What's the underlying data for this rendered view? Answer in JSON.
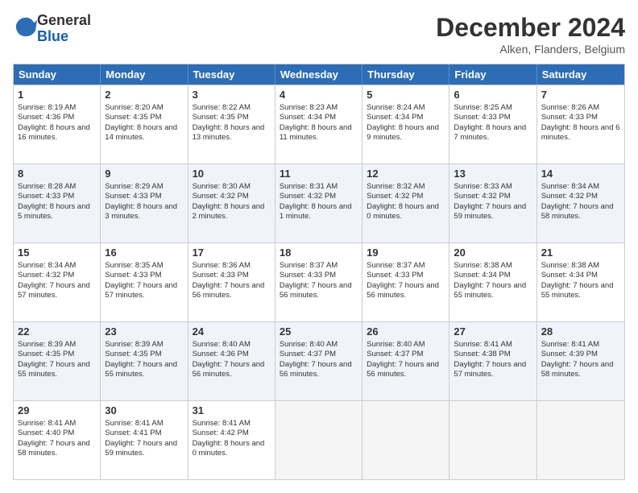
{
  "logo": {
    "line1": "General",
    "line2": "Blue"
  },
  "title": "December 2024",
  "location": "Alken, Flanders, Belgium",
  "days": [
    "Sunday",
    "Monday",
    "Tuesday",
    "Wednesday",
    "Thursday",
    "Friday",
    "Saturday"
  ],
  "weeks": [
    [
      {
        "day": "1",
        "info": "Sunrise: 8:19 AM\nSunset: 4:36 PM\nDaylight: 8 hours and 16 minutes."
      },
      {
        "day": "2",
        "info": "Sunrise: 8:20 AM\nSunset: 4:35 PM\nDaylight: 8 hours and 14 minutes."
      },
      {
        "day": "3",
        "info": "Sunrise: 8:22 AM\nSunset: 4:35 PM\nDaylight: 8 hours and 13 minutes."
      },
      {
        "day": "4",
        "info": "Sunrise: 8:23 AM\nSunset: 4:34 PM\nDaylight: 8 hours and 11 minutes."
      },
      {
        "day": "5",
        "info": "Sunrise: 8:24 AM\nSunset: 4:34 PM\nDaylight: 8 hours and 9 minutes."
      },
      {
        "day": "6",
        "info": "Sunrise: 8:25 AM\nSunset: 4:33 PM\nDaylight: 8 hours and 7 minutes."
      },
      {
        "day": "7",
        "info": "Sunrise: 8:26 AM\nSunset: 4:33 PM\nDaylight: 8 hours and 6 minutes."
      }
    ],
    [
      {
        "day": "8",
        "info": "Sunrise: 8:28 AM\nSunset: 4:33 PM\nDaylight: 8 hours and 5 minutes."
      },
      {
        "day": "9",
        "info": "Sunrise: 8:29 AM\nSunset: 4:33 PM\nDaylight: 8 hours and 3 minutes."
      },
      {
        "day": "10",
        "info": "Sunrise: 8:30 AM\nSunset: 4:32 PM\nDaylight: 8 hours and 2 minutes."
      },
      {
        "day": "11",
        "info": "Sunrise: 8:31 AM\nSunset: 4:32 PM\nDaylight: 8 hours and 1 minute."
      },
      {
        "day": "12",
        "info": "Sunrise: 8:32 AM\nSunset: 4:32 PM\nDaylight: 8 hours and 0 minutes."
      },
      {
        "day": "13",
        "info": "Sunrise: 8:33 AM\nSunset: 4:32 PM\nDaylight: 7 hours and 59 minutes."
      },
      {
        "day": "14",
        "info": "Sunrise: 8:34 AM\nSunset: 4:32 PM\nDaylight: 7 hours and 58 minutes."
      }
    ],
    [
      {
        "day": "15",
        "info": "Sunrise: 8:34 AM\nSunset: 4:32 PM\nDaylight: 7 hours and 57 minutes."
      },
      {
        "day": "16",
        "info": "Sunrise: 8:35 AM\nSunset: 4:33 PM\nDaylight: 7 hours and 57 minutes."
      },
      {
        "day": "17",
        "info": "Sunrise: 8:36 AM\nSunset: 4:33 PM\nDaylight: 7 hours and 56 minutes."
      },
      {
        "day": "18",
        "info": "Sunrise: 8:37 AM\nSunset: 4:33 PM\nDaylight: 7 hours and 56 minutes."
      },
      {
        "day": "19",
        "info": "Sunrise: 8:37 AM\nSunset: 4:33 PM\nDaylight: 7 hours and 56 minutes."
      },
      {
        "day": "20",
        "info": "Sunrise: 8:38 AM\nSunset: 4:34 PM\nDaylight: 7 hours and 55 minutes."
      },
      {
        "day": "21",
        "info": "Sunrise: 8:38 AM\nSunset: 4:34 PM\nDaylight: 7 hours and 55 minutes."
      }
    ],
    [
      {
        "day": "22",
        "info": "Sunrise: 8:39 AM\nSunset: 4:35 PM\nDaylight: 7 hours and 55 minutes."
      },
      {
        "day": "23",
        "info": "Sunrise: 8:39 AM\nSunset: 4:35 PM\nDaylight: 7 hours and 55 minutes."
      },
      {
        "day": "24",
        "info": "Sunrise: 8:40 AM\nSunset: 4:36 PM\nDaylight: 7 hours and 56 minutes."
      },
      {
        "day": "25",
        "info": "Sunrise: 8:40 AM\nSunset: 4:37 PM\nDaylight: 7 hours and 56 minutes."
      },
      {
        "day": "26",
        "info": "Sunrise: 8:40 AM\nSunset: 4:37 PM\nDaylight: 7 hours and 56 minutes."
      },
      {
        "day": "27",
        "info": "Sunrise: 8:41 AM\nSunset: 4:38 PM\nDaylight: 7 hours and 57 minutes."
      },
      {
        "day": "28",
        "info": "Sunrise: 8:41 AM\nSunset: 4:39 PM\nDaylight: 7 hours and 58 minutes."
      }
    ],
    [
      {
        "day": "29",
        "info": "Sunrise: 8:41 AM\nSunset: 4:40 PM\nDaylight: 7 hours and 58 minutes."
      },
      {
        "day": "30",
        "info": "Sunrise: 8:41 AM\nSunset: 4:41 PM\nDaylight: 7 hours and 59 minutes."
      },
      {
        "day": "31",
        "info": "Sunrise: 8:41 AM\nSunset: 4:42 PM\nDaylight: 8 hours and 0 minutes."
      },
      {
        "day": "",
        "info": ""
      },
      {
        "day": "",
        "info": ""
      },
      {
        "day": "",
        "info": ""
      },
      {
        "day": "",
        "info": ""
      }
    ]
  ]
}
